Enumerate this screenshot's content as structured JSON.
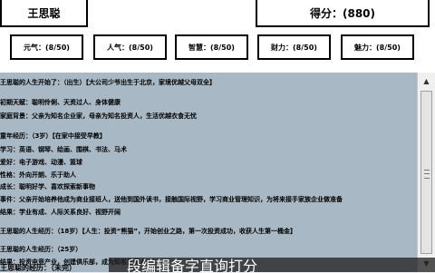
{
  "header": {
    "player_name": "王思聪",
    "score_text": "得分：(880)"
  },
  "stats": [
    {
      "label": "元气：(8/50)"
    },
    {
      "label": "人气：(8/50)"
    },
    {
      "label": "智慧：(8/50)"
    },
    {
      "label": "财力：(8/50)"
    },
    {
      "label": "魅力：(8/50)"
    }
  ],
  "log": {
    "lines": [
      "王思聪的人生开始了：（出生）【大公司少爷出生于北京，家境优越父母双全】",
      "初期天赋：聪明伶俐、天资过人、身体健康",
      "家庭背景：父亲为知名企业家，母亲为知名投资人，生活优越衣食无忧",
      "",
      "童年经历：（3岁）【在家中接受早教】",
      "学习：英语、钢琴、绘画、围棋、书法、马术",
      "爱好：电子游戏、动漫、篮球",
      "性格：外向开朗、乐于助人",
      "成长：聪明好学、喜欢探索新事物",
      "事件：父亲开始培养他成为商业接班人，送他到国外读书，接触国际视野，学习商业管理知识，为将来接手家族企业做准备",
      "结果：学业有成、人际关系良好、视野开阔",
      "",
      "王思聪的人生经历：（18岁）【人生：投资“熊猫”，开始创业之路，第一次投资成功，收获人生第一桶金】",
      "",
      "王思聪的人生经历：（25岁）",
      "结果：投资电竞产业，创建俱乐部，成为知名投资人"
    ]
  },
  "footer": {
    "status_text": "王思聪的经历：（未完）",
    "subtitle": "段编辑备字直询打分"
  }
}
